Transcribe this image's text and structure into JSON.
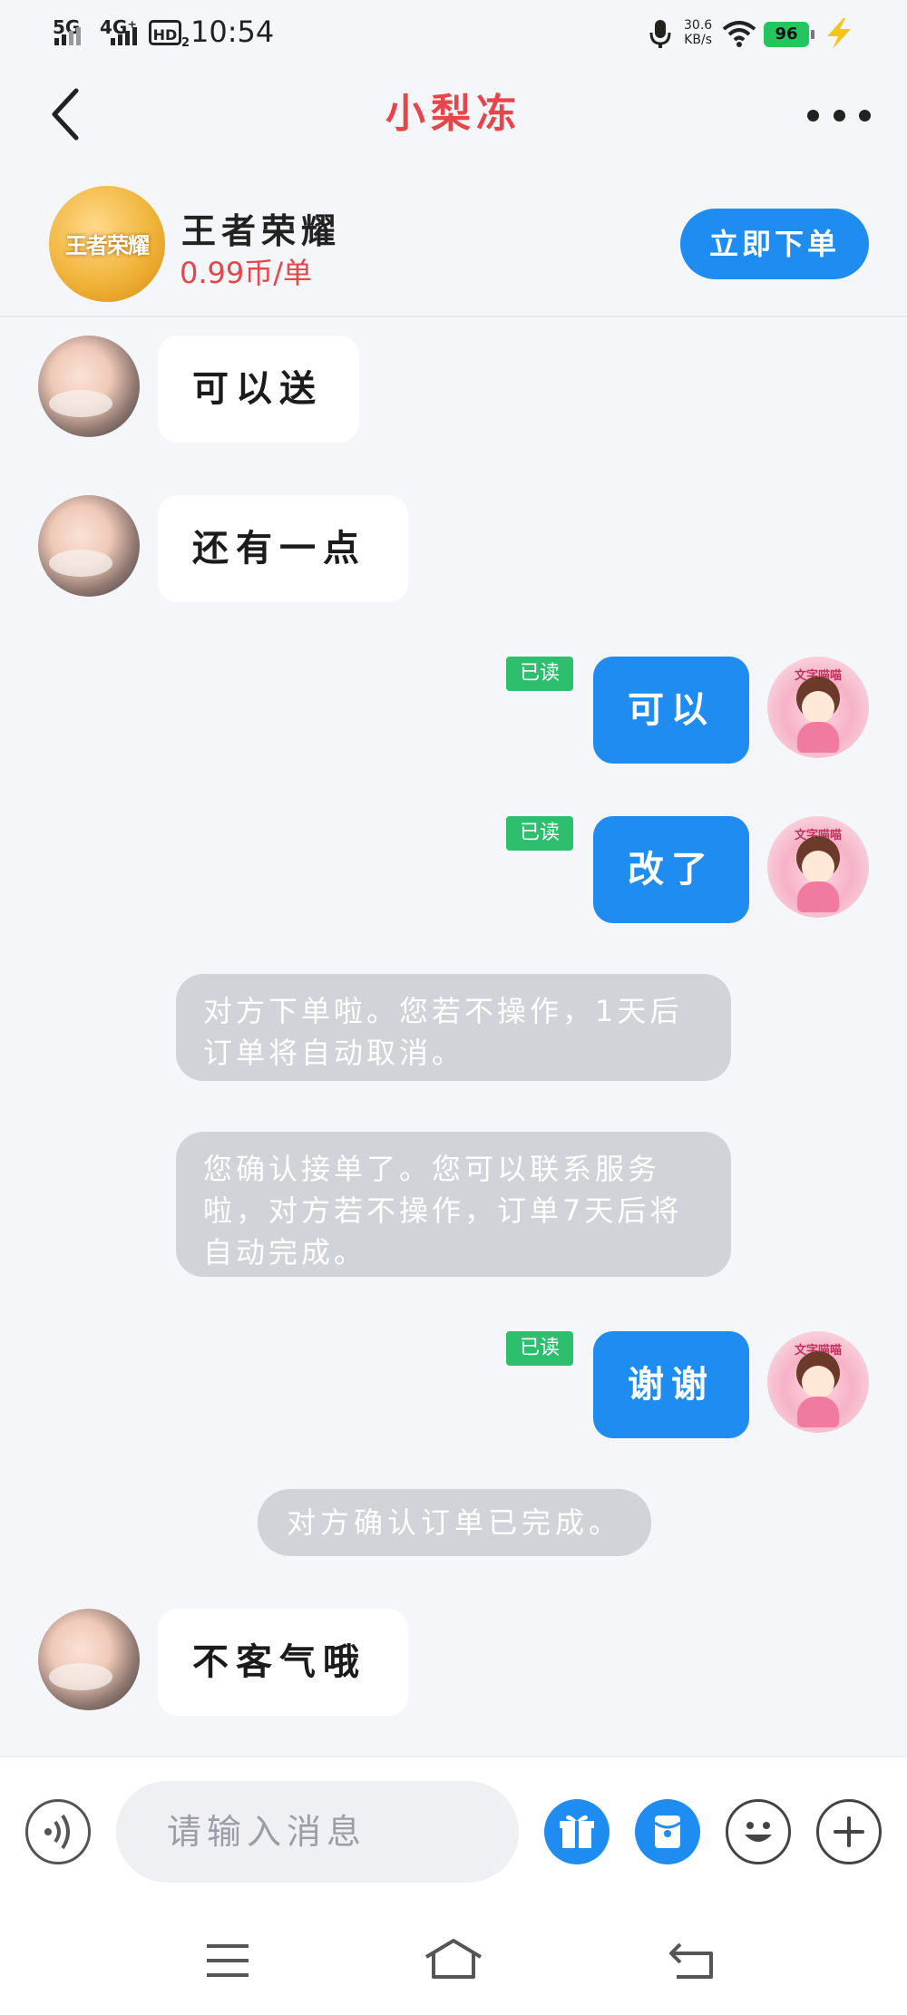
{
  "status_bar": {
    "net1": "5G",
    "net2": "4G⁺",
    "hd": "HD",
    "hd_sub": "2",
    "time": "10:54",
    "speed_value": "30.6",
    "speed_unit": "KB/s",
    "battery": "96",
    "icons": [
      "signal-icon",
      "hd-call-icon",
      "mic-icon",
      "wifi-icon",
      "battery-icon",
      "charging-icon"
    ]
  },
  "header": {
    "title": "小梨冻",
    "title_color": "#e8454a",
    "icons": [
      "back-arrow-icon",
      "more-dots-icon"
    ]
  },
  "product": {
    "logo_text": "王者荣耀",
    "name": "王者荣耀",
    "price": "0.99币/单",
    "order_button": "立即下单",
    "accent": "#1e8cf0"
  },
  "messages": [
    {
      "side": "left",
      "text": "可以送"
    },
    {
      "side": "left",
      "text": "还有一点"
    },
    {
      "side": "right",
      "text": "可以",
      "status": "已读"
    },
    {
      "side": "right",
      "text": "改了",
      "status": "已读"
    },
    {
      "side": "system",
      "text": "对方下单啦。您若不操作，1天后订单将自动取消。"
    },
    {
      "side": "system",
      "text": "您确认接单了。您可以联系服务啦，对方若不操作，订单7天后将自动完成。"
    },
    {
      "side": "right",
      "text": "谢谢",
      "status": "已读"
    },
    {
      "side": "system",
      "text": "对方确认订单已完成。"
    },
    {
      "side": "left",
      "text": "不客气哦"
    }
  ],
  "avatar_right_banner": "文字喵喵",
  "composer": {
    "placeholder": "请输入消息",
    "icons": [
      "voice-icon",
      "gift-icon",
      "red-packet-icon",
      "emoji-icon",
      "plus-icon"
    ]
  },
  "system_nav": {
    "icons": [
      "menu-icon",
      "home-icon",
      "back-icon"
    ]
  }
}
